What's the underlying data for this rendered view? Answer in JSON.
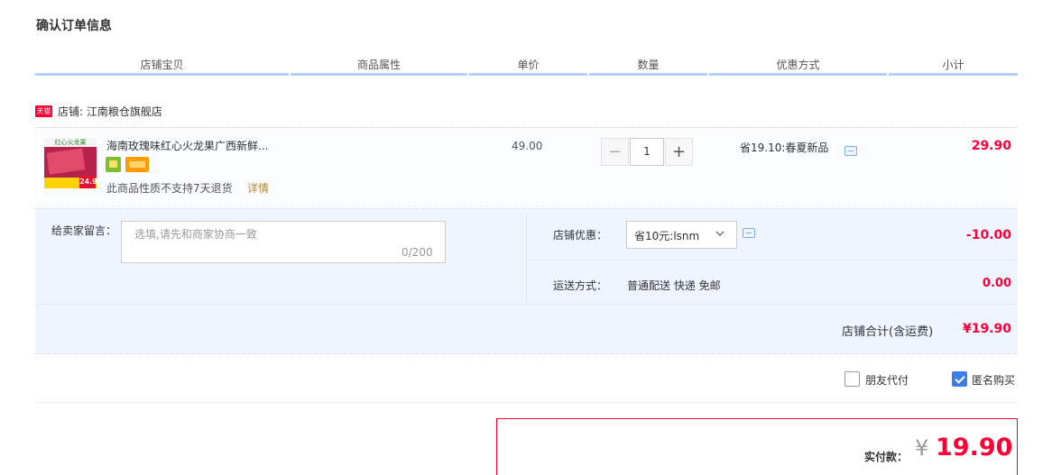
{
  "page": {
    "title": "确认订单信息"
  },
  "table_header": [
    "店铺宝贝",
    "商品属性",
    "单价",
    "数量",
    "优惠方式",
    "小计"
  ],
  "shop": {
    "badge": "天猫",
    "label": "店铺: 江南粮仓旗舰店"
  },
  "item": {
    "thumbnail": {
      "top_text": "红心火龙果",
      "badge_text": "24.9"
    },
    "title": "海南玫瑰味红心火龙果广西新鲜...",
    "service_icons": [
      "shopping-bag-icon",
      "credit-card-icon"
    ],
    "no_return_text": "此商品性质不支持7天退货",
    "detail_link": "详情",
    "unit_price": "49.00",
    "quantity": "1",
    "minus": "−",
    "plus": "+",
    "promotion": "省19.10:春夏新品",
    "subtotal": "29.90"
  },
  "message": {
    "label": "给卖家留言：",
    "placeholder": "选填,请先和商家协商一致",
    "counter": "0/200"
  },
  "shop_discount": {
    "label": "店铺优惠：",
    "selected": "省10元:lsnm",
    "amount": "-10.00"
  },
  "shipping": {
    "label": "运送方式：",
    "value": "普通配送 快递 免邮",
    "amount": "0.00"
  },
  "shop_total": {
    "label": "店铺合计(含运费)",
    "amount": "¥19.90"
  },
  "options": {
    "friend_pay": {
      "label": "朋友代付",
      "checked": false
    },
    "anonymous": {
      "label": "匿名购买",
      "checked": true
    }
  },
  "payment": {
    "label": "实付款：",
    "currency": "¥",
    "amount": "19.90"
  },
  "colors": {
    "accent_red": "#ff0036",
    "header_bar": "#b2d1ff",
    "checkbox_blue": "#3d7dea",
    "panel_bg": "#eff5ff"
  }
}
